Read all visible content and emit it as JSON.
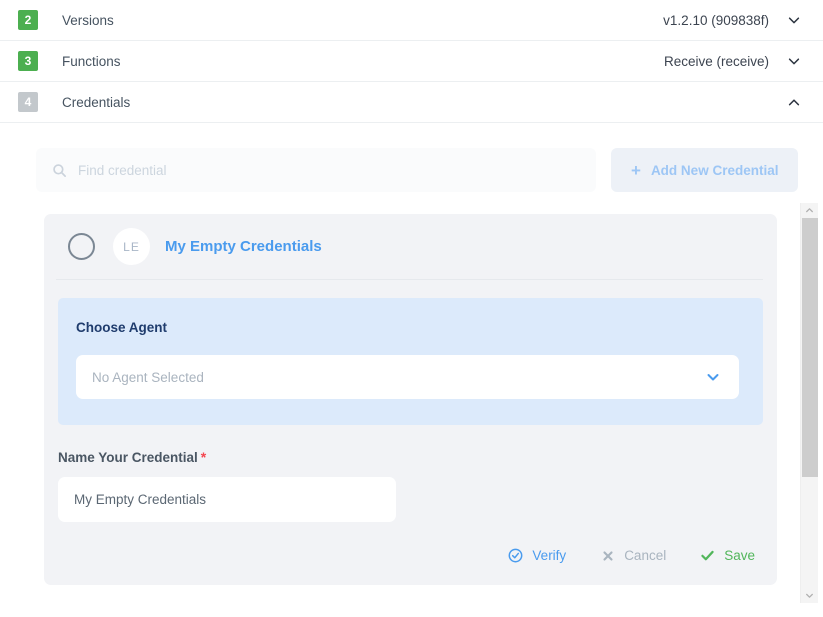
{
  "accordion": {
    "rows": [
      {
        "step": "2",
        "label": "Versions",
        "value": "v1.2.10 (909838f)",
        "chevron": "chevron-down-icon",
        "state": "collapsed",
        "badge_color": "#4caf50"
      },
      {
        "step": "3",
        "label": "Functions",
        "value": "Receive (receive)",
        "chevron": "chevron-down-icon",
        "state": "collapsed",
        "badge_color": "#4caf50"
      },
      {
        "step": "4",
        "label": "Credentials",
        "value": "",
        "chevron": "chevron-up-icon",
        "state": "expanded",
        "badge_color": "#c3c8cc"
      }
    ]
  },
  "toolbar": {
    "search": {
      "icon": "search-icon",
      "placeholder": "Find credential",
      "value": ""
    },
    "add_button": {
      "icon": "plus-icon",
      "plus": "+",
      "label": "Add New Credential"
    }
  },
  "credential_card": {
    "radio_selected": false,
    "avatar_initials": "LE",
    "title": "My Empty Credentials",
    "agent_section": {
      "label": "Choose Agent",
      "select_value": "No Agent Selected",
      "chevron": "chevron-down-icon"
    },
    "name_field": {
      "label": "Name Your Credential",
      "required_marker": "*",
      "value": "My Empty Credentials",
      "placeholder": "Name Your Credential"
    },
    "actions": [
      {
        "label": "Verify",
        "icon": "check-circle-icon",
        "color": "#4a9bee"
      },
      {
        "label": "Cancel",
        "icon": "close-x-icon",
        "color": "#a9b4bf"
      },
      {
        "label": "Save",
        "icon": "check-icon",
        "color": "#52b65b"
      }
    ]
  },
  "scrollbar": {
    "up_icon": "chevron-up-icon",
    "down_icon": "chevron-down-icon",
    "thumb_position_percent": 0,
    "thumb_size_percent": 70
  },
  "colors": {
    "accent_blue": "#4a9bee",
    "green": "#4caf50",
    "save_green": "#52b65b",
    "required_red": "#f4464f",
    "agent_panel_bg": "#dceafb",
    "card_bg": "#f2f3f6"
  }
}
